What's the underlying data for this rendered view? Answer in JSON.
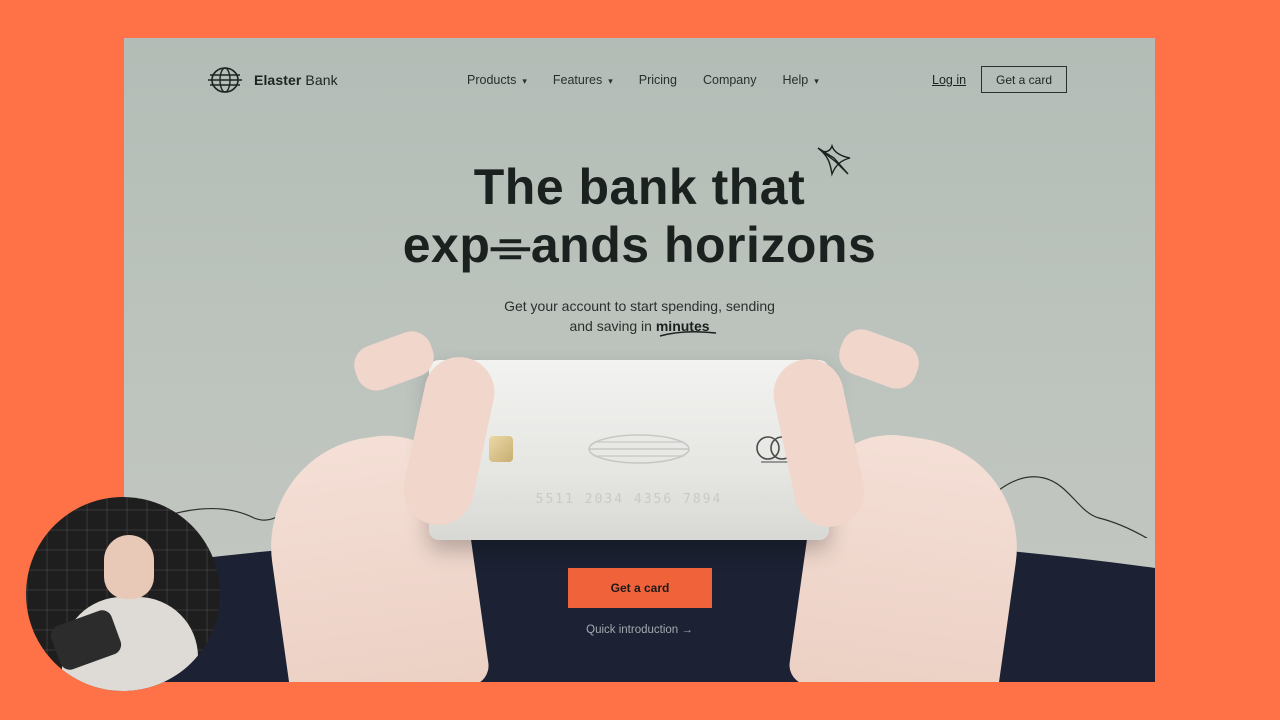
{
  "brand": {
    "name_bold": "Elaster",
    "name_light": " Bank"
  },
  "nav": [
    {
      "label": "Products",
      "has_menu": true
    },
    {
      "label": "Features",
      "has_menu": true
    },
    {
      "label": "Pricing",
      "has_menu": false
    },
    {
      "label": "Company",
      "has_menu": false
    },
    {
      "label": "Help",
      "has_menu": true
    }
  ],
  "header": {
    "login": "Log in",
    "cta": "Get a card"
  },
  "hero": {
    "line1": "The bank that",
    "line2": "exp⌯ands horizons",
    "sub_line1": "Get your account to start spending, sending",
    "sub_line2_prefix": "and saving in ",
    "sub_highlight": "minutes"
  },
  "card": {
    "number": "5511 2034 4356 7894"
  },
  "cta": {
    "main": "Get a card",
    "secondary": "Quick introduction →"
  },
  "colors": {
    "accent": "#f0623a",
    "frame": "#ff7247",
    "dark": "#1c2233",
    "bg": "#b8bfb9"
  },
  "icons": {
    "chevron": "▾"
  }
}
